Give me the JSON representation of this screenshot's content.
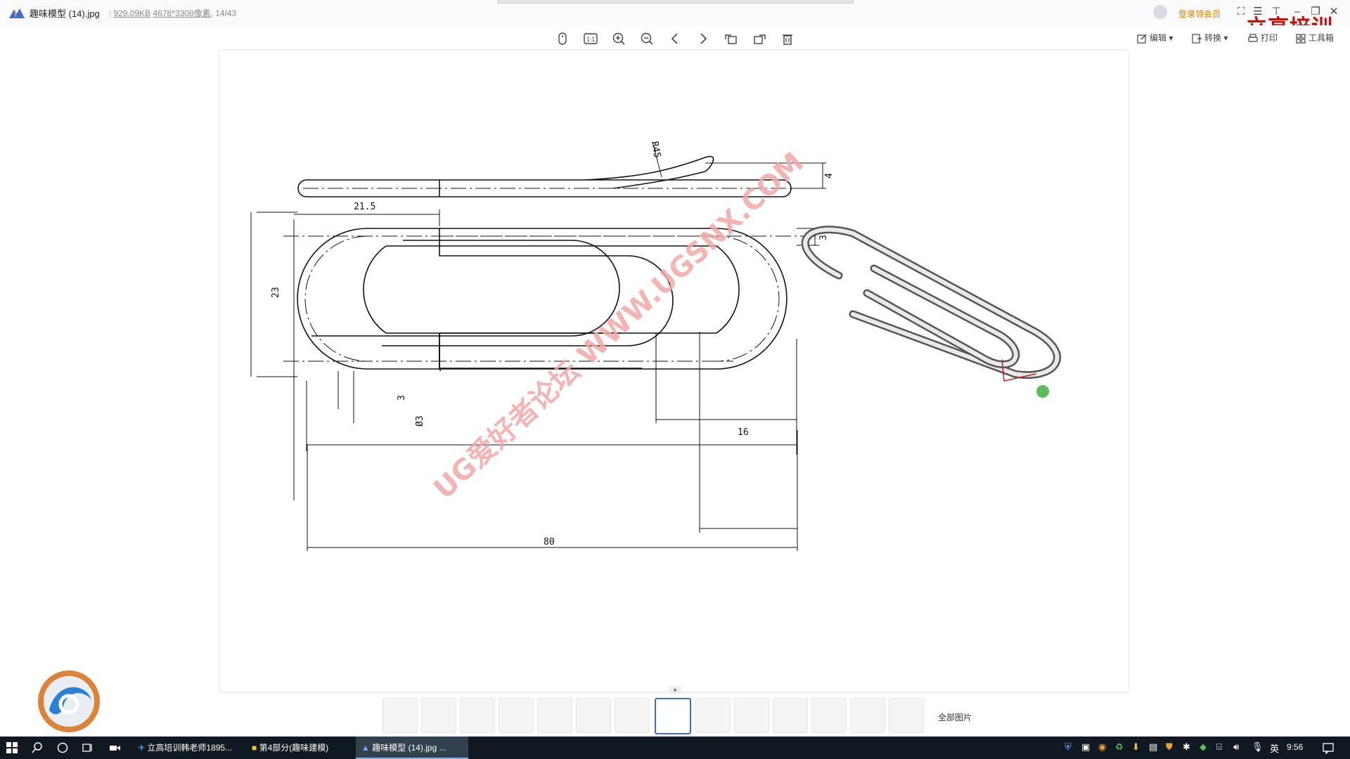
{
  "titlebar": {
    "file_name": "趣味模型 (14).jpg",
    "file_size": "929.09KB",
    "dimensions": "4678*3308像素",
    "page_index": "14/43",
    "vip_label": "登录领会员",
    "watermark_title": "立高培训"
  },
  "toolbar": {
    "buttons": [
      "mouse-icon",
      "actual-size-icon",
      "zoom-in-icon",
      "zoom-out-icon",
      "prev-icon",
      "next-icon",
      "rotate-left-icon",
      "rotate-right-icon",
      "delete-icon"
    ],
    "edit_label": "编辑",
    "convert_label": "转换",
    "print_label": "打印",
    "toolbox_label": "工具箱"
  },
  "drawing": {
    "watermark": "UG爱好者论坛 WWW.UGSNX.COM",
    "dims": {
      "r45": "R45",
      "d4": "4",
      "d21_5": "21.5",
      "d3_top": "3",
      "d23": "23",
      "d3_bottom": "3",
      "phi3": "Ø3",
      "d16": "16",
      "d80": "80"
    }
  },
  "thumbnails": {
    "count": 14,
    "active_index": 7,
    "all_label": "全部图片"
  },
  "taskbar": {
    "items": [
      {
        "label": "立高培训韩老师1895..."
      },
      {
        "label": "第4部分(趣味建模)"
      },
      {
        "label": "趣味模型 (14).jpg  ..."
      }
    ],
    "ime": "英",
    "clock": "9:56"
  },
  "colors": {
    "watermark": "#f2a7a7",
    "taskbar": "#101820",
    "accent": "#3a6fd8",
    "vip": "#e07a00"
  }
}
